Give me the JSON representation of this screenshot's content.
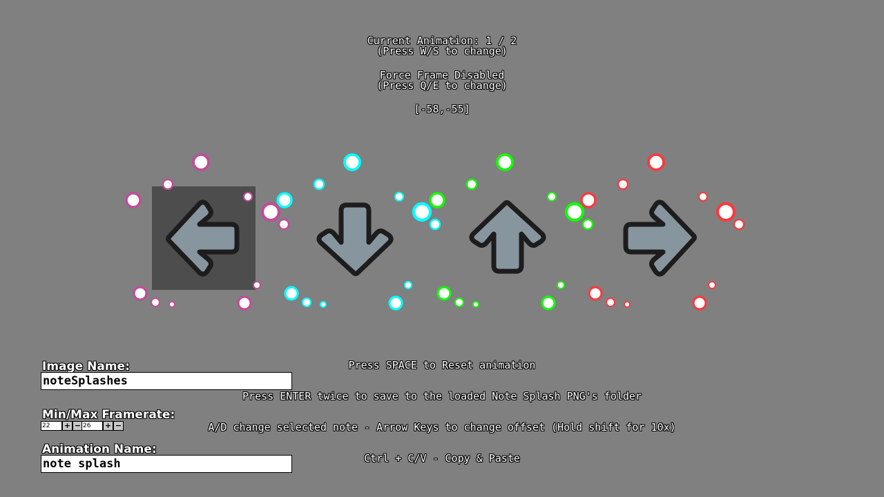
{
  "header": {
    "current_animation": "Current Animation: 1 / 2",
    "animation_hint": "(Press W/S to change)",
    "force_frame": "Force Frame Disabled",
    "force_frame_hint": "(Press Q/E to change)",
    "offset": "[-58,-55]"
  },
  "notes": {
    "selected_index": 0,
    "arrow_fill": "#87959f",
    "arrow_outline": "#1d1d1d",
    "selection_color": "#4d4d4d",
    "items": [
      {
        "direction": "left",
        "splash_color": "#c24b99",
        "icon": "arrow-left-icon"
      },
      {
        "direction": "down",
        "splash_color": "#00ffff",
        "icon": "arrow-down-icon"
      },
      {
        "direction": "up",
        "splash_color": "#12fa05",
        "icon": "arrow-up-icon"
      },
      {
        "direction": "right",
        "splash_color": "#f9393f",
        "icon": "arrow-right-icon"
      }
    ]
  },
  "editor": {
    "image_name_label": "Image Name:",
    "image_name_value": "noteSplashes",
    "framerate_label": "Min/Max Framerate:",
    "min_fps": "22",
    "max_fps": "26",
    "plus": "+",
    "minus": "−",
    "animation_name_label": "Animation Name:",
    "animation_name_value": "note splash"
  },
  "hints": {
    "reset": "Press SPACE to Reset animation",
    "save": "Press ENTER twice to save to the loaded Note Splash PNG's folder",
    "controls": "A/D change selected note - Arrow Keys to change offset (Hold shift for 10x)",
    "clipboard": "Ctrl + C/V - Copy & Paste"
  }
}
